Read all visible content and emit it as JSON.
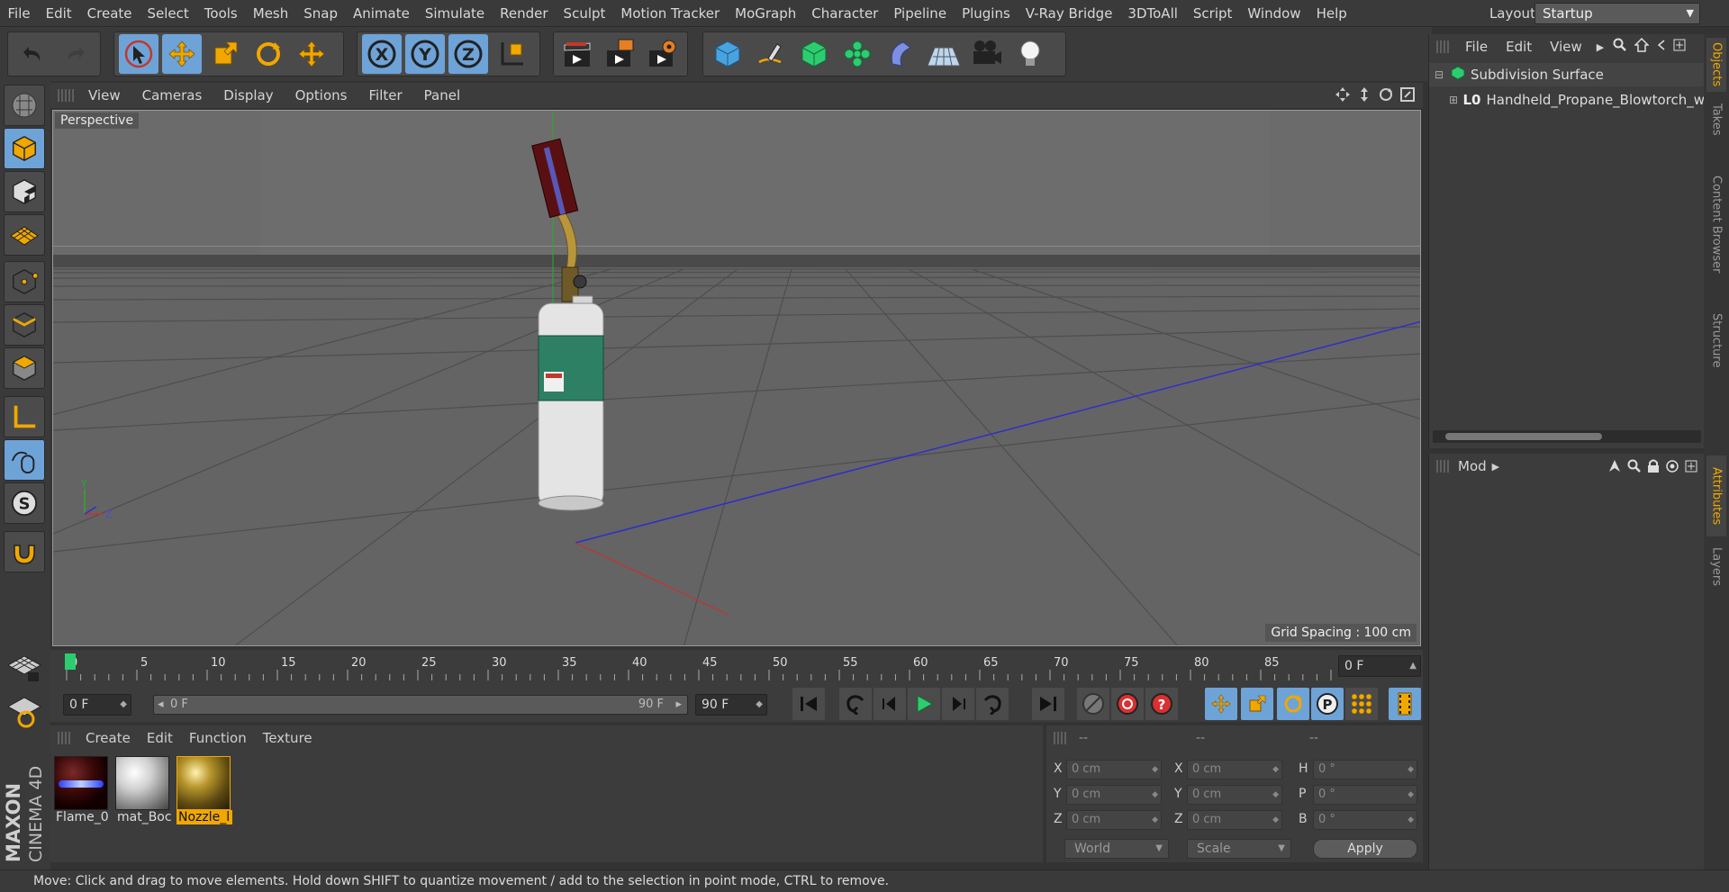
{
  "menubar": {
    "items": [
      "File",
      "Edit",
      "Create",
      "Select",
      "Tools",
      "Mesh",
      "Snap",
      "Animate",
      "Simulate",
      "Render",
      "Sculpt",
      "Motion Tracker",
      "MoGraph",
      "Character",
      "Pipeline",
      "Plugins",
      "V-Ray Bridge",
      "3DToAll",
      "Script",
      "Window",
      "Help"
    ],
    "layout_label": "Layout:",
    "layout_value": "Startup"
  },
  "viewport": {
    "menu": [
      "View",
      "Cameras",
      "Display",
      "Options",
      "Filter",
      "Panel"
    ],
    "camera_label": "Perspective",
    "grid_spacing": "Grid Spacing : 100 cm"
  },
  "objects": {
    "menu": [
      "File",
      "Edit",
      "View"
    ],
    "rows": [
      "Subdivision Surface",
      "Handheld_Propane_Blowtorch_w"
    ]
  },
  "attributes": {
    "mode_label": "Mod"
  },
  "side_tabs": [
    "Objects",
    "Takes",
    "Content Browser",
    "Structure",
    "Attributes",
    "Layers"
  ],
  "timeline": {
    "ticks": [
      "0",
      "5",
      "10",
      "15",
      "20",
      "25",
      "30",
      "35",
      "40",
      "45",
      "50",
      "55",
      "60",
      "65",
      "70",
      "75",
      "80",
      "85",
      "90"
    ],
    "current_frame": "0 F"
  },
  "transport": {
    "start_field": "0 F",
    "range_start": "0 F",
    "range_end": "90 F",
    "end_field": "90 F"
  },
  "materials": {
    "menu": [
      "Create",
      "Edit",
      "Function",
      "Texture"
    ],
    "items": [
      {
        "name": "Flame_0",
        "selected": false
      },
      {
        "name": "mat_Boc",
        "selected": false
      },
      {
        "name": "Nozzle_l",
        "selected": true
      }
    ]
  },
  "coordinates": {
    "headers": [
      "--",
      "--",
      "--"
    ],
    "rows": [
      {
        "a_label": "X",
        "a_val": "0 cm",
        "b_label": "X",
        "b_val": "0 cm",
        "c_label": "H",
        "c_val": "0 °"
      },
      {
        "a_label": "Y",
        "a_val": "0 cm",
        "b_label": "Y",
        "b_val": "0 cm",
        "c_label": "P",
        "c_val": "0 °"
      },
      {
        "a_label": "Z",
        "a_val": "0 cm",
        "b_label": "Z",
        "b_val": "0 cm",
        "c_label": "B",
        "c_val": "0 °"
      }
    ],
    "world_label": "World",
    "scale_label": "Scale",
    "apply_label": "Apply"
  },
  "logo": {
    "brand": "MAXON",
    "product": "CINEMA 4D"
  },
  "status": "Move: Click and drag to move elements. Hold down SHIFT to quantize movement / add to the selection in point mode, CTRL to remove.",
  "colors": {
    "accent": "#6ea3d8",
    "selection": "#f0a800",
    "panel": "#3c3c3c"
  }
}
